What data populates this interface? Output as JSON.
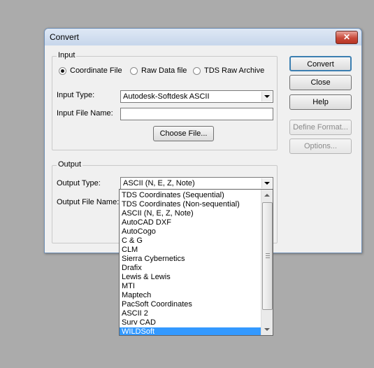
{
  "window": {
    "title": "Convert",
    "close_glyph": "✕"
  },
  "input": {
    "group_label": "Input",
    "radios": [
      {
        "label": "Coordinate File",
        "checked": true
      },
      {
        "label": "Raw Data file",
        "checked": false
      },
      {
        "label": "TDS Raw Archive",
        "checked": false
      }
    ],
    "type_label": "Input Type:",
    "type_value": "Autodesk-Softdesk ASCII",
    "file_label": "Input File Name:",
    "file_value": "",
    "choose_button": "Choose File..."
  },
  "output": {
    "group_label": "Output",
    "type_label": "Output Type:",
    "type_value": "ASCII (N, E, Z, Note)",
    "file_label": "Output File Name:"
  },
  "buttons": {
    "convert": "Convert",
    "close": "Close",
    "help": "Help",
    "define_format": "Define Format...",
    "options": "Options..."
  },
  "dropdown": {
    "items": [
      "TDS Coordinates (Sequential)",
      "TDS Coordinates (Non-sequential)",
      "ASCII (N, E, Z, Note)",
      "AutoCAD DXF",
      "AutoCogo",
      "C & G",
      "CLM",
      "Sierra Cybernetics",
      "Drafix",
      "Lewis & Lewis",
      "MTI",
      "Maptech",
      "PacSoft Coordinates",
      "ASCII 2",
      "Surv CAD",
      "WILDSoft"
    ],
    "selected_index": 15
  },
  "colors": {
    "background": "#ababab",
    "selection": "#3399ff",
    "close_button": "#c94a3a"
  }
}
